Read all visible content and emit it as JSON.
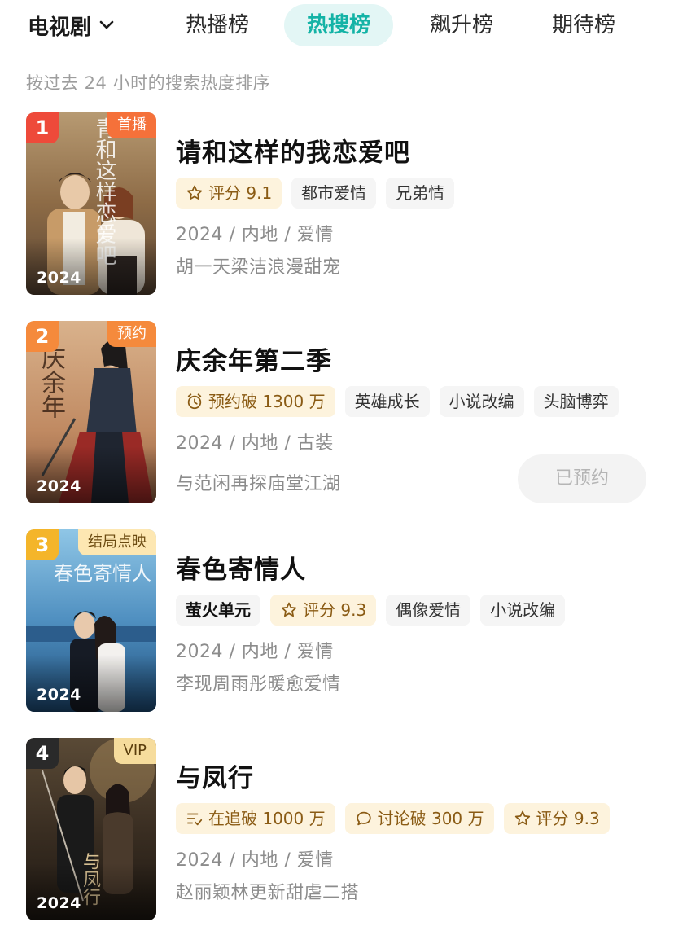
{
  "header": {
    "category": "电视剧",
    "tabs": [
      "热播榜",
      "热搜榜",
      "飙升榜",
      "期待榜"
    ],
    "active_tab": "热搜榜",
    "subtitle": "按过去 24 小时的搜索热度排序"
  },
  "icons": {
    "category_dropdown": "chevron-down-icon",
    "rating": "star-icon",
    "reservation": "alarm-clock-icon",
    "following": "list-check-icon",
    "discussion": "chat-bubble-icon"
  },
  "colors": {
    "accent": "#14b3a6",
    "active_tab_bg": "#e3f6f5",
    "rank_1": "#ee4a3a",
    "rank_2": "#f58a3c",
    "rank_3": "#f4b52a",
    "rank_4": "#2a2a2a",
    "gold_tag_bg": "#fdf3dd",
    "gold_tag_text": "#8a5b14"
  },
  "items": [
    {
      "rank": "1",
      "badge": "首播",
      "year_overlay": "2024",
      "poster_title": "青和这样恋爱吧",
      "title": "请和这样的我恋爱吧",
      "tag1": "评分 9.1",
      "tag2": "都市爱情",
      "tag3": "兄弟情",
      "meta": "2024 / 内地 / 爱情",
      "desc": "胡一天梁洁浪漫甜宠"
    },
    {
      "rank": "2",
      "badge": "预约",
      "year_overlay": "2024",
      "poster_title": "庆余年",
      "title": "庆余年第二季",
      "tag1": "预约破 1300 万",
      "tag2": "英雄成长",
      "tag3": "小说改编",
      "tag4": "头脑博弈",
      "meta": "2024 / 内地 / 古装",
      "desc": "与范闲再探庙堂江湖",
      "button": "已预约"
    },
    {
      "rank": "3",
      "badge": "结局点映",
      "year_overlay": "2024",
      "poster_title": "春色寄情人",
      "title": "春色寄情人",
      "tag0": "萤火单元",
      "tag1": "评分 9.3",
      "tag2": "偶像爱情",
      "tag3": "小说改编",
      "meta": "2024 / 内地 / 爱情",
      "desc": "李现周雨彤暖愈爱情"
    },
    {
      "rank": "4",
      "badge": "VIP",
      "year_overlay": "2024",
      "poster_title": "与凤行",
      "title": "与凤行",
      "tag1": "在追破 1000 万",
      "tag2": "讨论破 300 万",
      "tag3": "评分 9.3",
      "meta": "2024 / 内地 / 爱情",
      "desc": "赵丽颖林更新甜虐二搭"
    }
  ]
}
